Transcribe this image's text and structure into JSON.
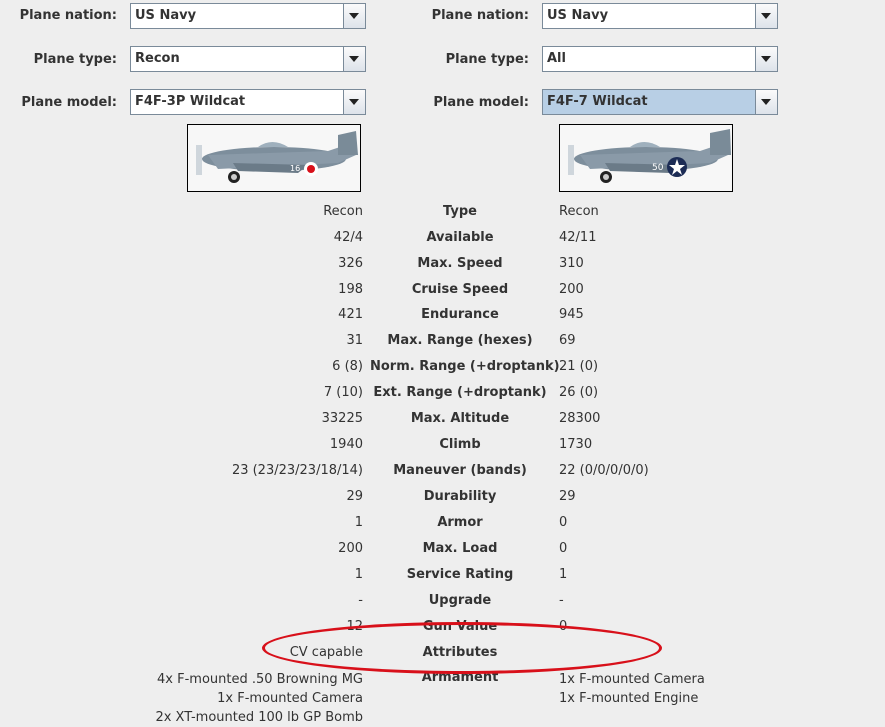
{
  "left": {
    "nation_label": "Plane nation:",
    "nation_value": "US Navy",
    "type_label": "Plane type:",
    "type_value": "Recon",
    "model_label": "Plane model:",
    "model_value": "F4F-3P Wildcat"
  },
  "right": {
    "nation_label": "Plane nation:",
    "nation_value": "US Navy",
    "type_label": "Plane type:",
    "type_value": "All",
    "model_label": "Plane model:",
    "model_value": "F4F-7 Wildcat"
  },
  "stats": [
    {
      "name": "Type",
      "left": "Recon",
      "right": "Recon"
    },
    {
      "name": "Available",
      "left": "42/4",
      "right": "42/11"
    },
    {
      "name": "Max. Speed",
      "left": "326",
      "right": "310"
    },
    {
      "name": "Cruise Speed",
      "left": "198",
      "right": "200"
    },
    {
      "name": "Endurance",
      "left": "421",
      "right": "945"
    },
    {
      "name": "Max. Range (hexes)",
      "left": "31",
      "right": "69"
    },
    {
      "name": "Norm. Range (+droptank)",
      "left": "6 (8)",
      "right": "21 (0)"
    },
    {
      "name": "Ext. Range (+droptank)",
      "left": "7 (10)",
      "right": "26 (0)"
    },
    {
      "name": "Max. Altitude",
      "left": "33225",
      "right": "28300"
    },
    {
      "name": "Climb",
      "left": "1940",
      "right": "1730"
    },
    {
      "name": "Maneuver (bands)",
      "left": "23 (23/23/23/18/14)",
      "right": "22 (0/0/0/0/0)"
    },
    {
      "name": "Durability",
      "left": "29",
      "right": "29"
    },
    {
      "name": "Armor",
      "left": "1",
      "right": "0"
    },
    {
      "name": "Max. Load",
      "left": "200",
      "right": "0"
    },
    {
      "name": "Service Rating",
      "left": "1",
      "right": "1"
    },
    {
      "name": "Upgrade",
      "left": "-",
      "right": "-"
    },
    {
      "name": "Gun Value",
      "left": "12",
      "right": "0"
    },
    {
      "name": "Attributes",
      "left": "CV capable",
      "right": ""
    }
  ],
  "armament": {
    "name": "Armament",
    "left": [
      "4x F-mounted .50 Browning MG",
      "1x F-mounted Camera",
      "2x XT-mounted 100 lb GP Bomb"
    ],
    "right": [
      "1x F-mounted Camera",
      "1x F-mounted Engine"
    ]
  },
  "images": {
    "left_number": "16",
    "right_number": "50"
  },
  "colors": {
    "annotation": "#d8101a",
    "plane_body": "#7d8e9c"
  }
}
